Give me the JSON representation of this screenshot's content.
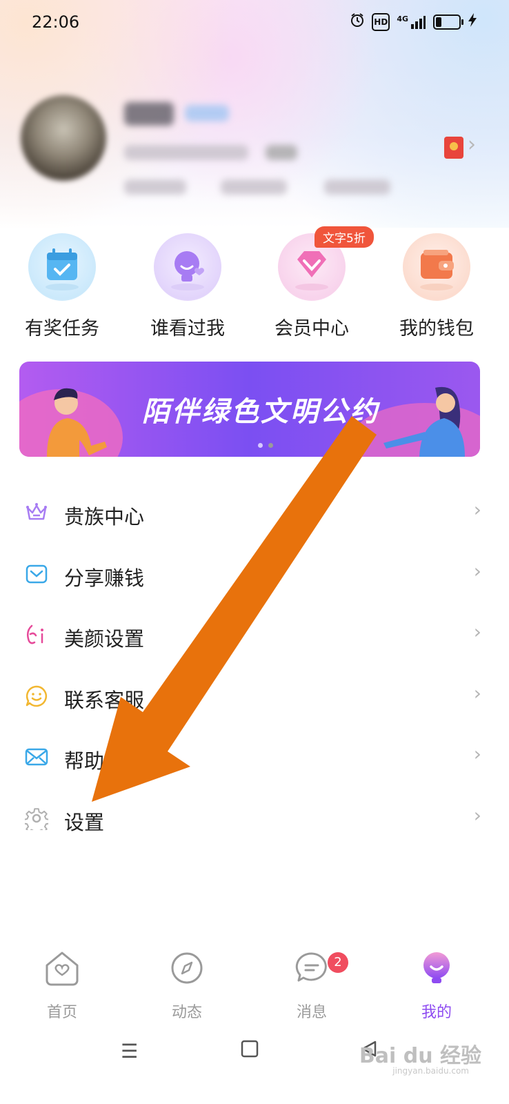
{
  "status_bar": {
    "time": "22:06",
    "icons": [
      "alarm-icon",
      "hd-icon",
      "signal-4g-icon",
      "battery-icon",
      "charging-icon"
    ],
    "hd_label": "HD",
    "network_label": "4G"
  },
  "quick_actions": [
    {
      "label": "有奖任务",
      "icon": "calendar-check-icon",
      "color": "#56b6f2"
    },
    {
      "label": "谁看过我",
      "icon": "visitor-icon",
      "color": "#a77cf3"
    },
    {
      "label": "会员中心",
      "icon": "diamond-icon",
      "color": "#f06fb7",
      "badge": "文字5折"
    },
    {
      "label": "我的钱包",
      "icon": "wallet-icon",
      "color": "#f2794b"
    }
  ],
  "banner": {
    "text": "陌伴绿色文明公约",
    "page_count": 2,
    "active_page": 2
  },
  "menu": [
    {
      "label": "贵族中心",
      "icon": "crown-icon",
      "color": "#a77cf3"
    },
    {
      "label": "分享赚钱",
      "icon": "envelope-icon",
      "color": "#3aa8e8"
    },
    {
      "label": "美颜设置",
      "icon": "beauty-icon",
      "color": "#e64a9a"
    },
    {
      "label": "联系客服",
      "icon": "smile-chat-icon",
      "color": "#f2b731"
    },
    {
      "label": "帮助与反馈",
      "icon": "mail-icon",
      "color": "#3aa8e8"
    },
    {
      "label": "设置",
      "icon": "gear-icon",
      "color": "#b0b0b0"
    }
  ],
  "tabs": [
    {
      "label": "首页",
      "icon": "home-heart-icon"
    },
    {
      "label": "动态",
      "icon": "compass-icon"
    },
    {
      "label": "消息",
      "icon": "chat-icon",
      "badge": "2"
    },
    {
      "label": "我的",
      "icon": "profile-face-icon",
      "active": true
    }
  ],
  "colors": {
    "accent": "#8e4bf1",
    "annotation_arrow": "#e8720c",
    "badge_red": "#f04d5f"
  },
  "watermark": {
    "text": "Bai du 经验",
    "sub": "jingyan.baidu.com"
  }
}
